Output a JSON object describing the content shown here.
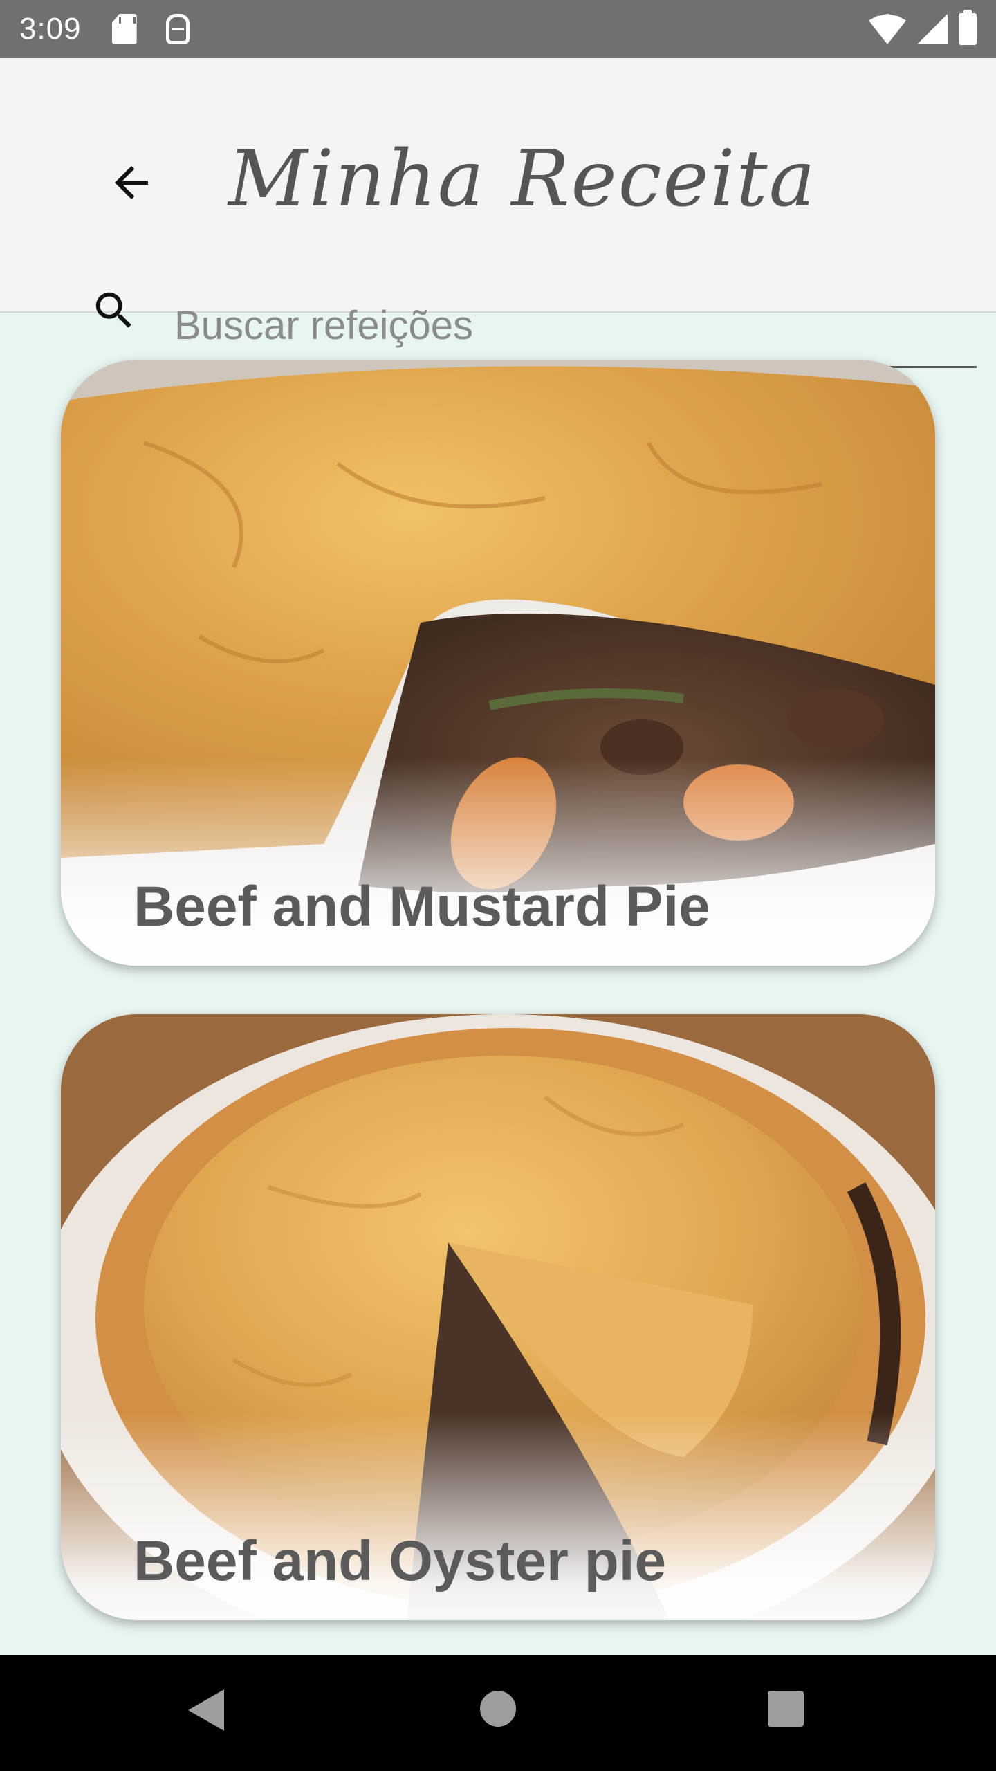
{
  "status_bar": {
    "time": "3:09",
    "icons": [
      "sd-card-icon",
      "android-debug-icon",
      "wifi-icon",
      "cell-signal-icon",
      "battery-icon"
    ]
  },
  "header": {
    "title": "Minha Receita",
    "back_icon": "arrow-back-icon"
  },
  "search": {
    "placeholder": "Buscar refeições",
    "value": "",
    "icon": "search-icon"
  },
  "meals": [
    {
      "name": "Beef and Mustard Pie"
    },
    {
      "name": "Beef and Oyster pie"
    }
  ],
  "nav_bar": {
    "buttons": [
      "nav-back-icon",
      "nav-home-icon",
      "nav-recents-icon"
    ]
  },
  "colors": {
    "status_bar": "#707070",
    "header_bg": "#f4f4f4",
    "page_bg": "#e8f6f2",
    "nav_bar": "#000000"
  }
}
